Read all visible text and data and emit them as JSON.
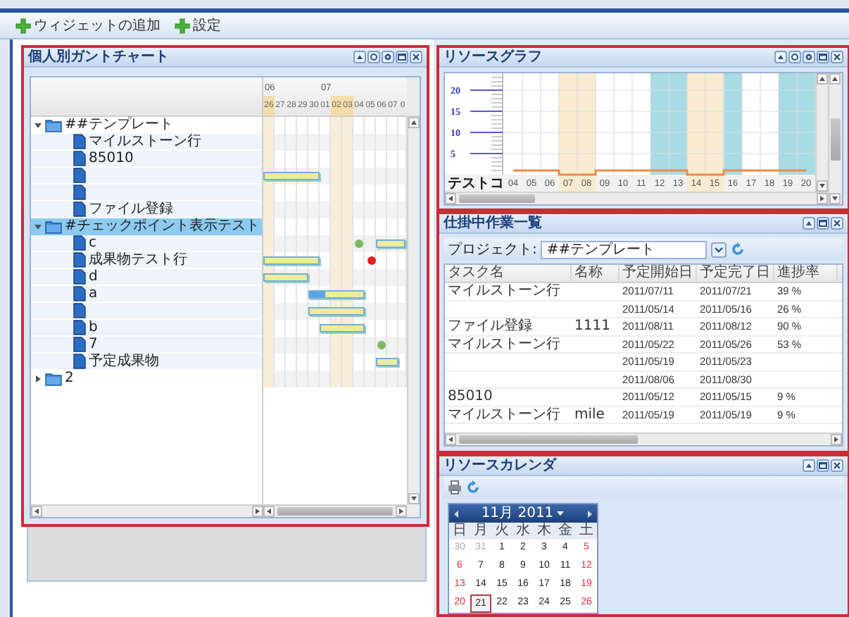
{
  "toolbar": {
    "buttons": [
      {
        "label": "ウィジェットの追加"
      },
      {
        "label": "設定"
      }
    ]
  },
  "gantt": {
    "title": "個人別ガントチャート",
    "months": [
      {
        "label": "06",
        "days": [
          {
            "label": "26",
            "weekend": true
          },
          {
            "label": "27",
            "weekend": false
          },
          {
            "label": "28",
            "weekend": false
          },
          {
            "label": "29",
            "weekend": false
          },
          {
            "label": "30",
            "weekend": false
          }
        ]
      },
      {
        "label": "07",
        "days": [
          {
            "label": "01",
            "weekend": false
          },
          {
            "label": "02",
            "weekend": true
          },
          {
            "label": "03",
            "weekend": true
          },
          {
            "label": "04",
            "weekend": false
          },
          {
            "label": "05",
            "weekend": false
          },
          {
            "label": "06",
            "weekend": false
          },
          {
            "label": "07",
            "weekend": false
          },
          {
            "label": "0",
            "weekend": false
          }
        ]
      }
    ],
    "tree": [
      {
        "label": "##テンプレート",
        "kind": "folder",
        "expanded": true,
        "selected": false,
        "children": [
          {
            "label": "マイルストーン行",
            "kind": "task",
            "selected": false
          },
          {
            "label": "85010",
            "kind": "task",
            "selected": false
          },
          {
            "kind": "task",
            "selected": false,
            "markers": [
              {
                "kind": "bar"
              }
            ]
          },
          {
            "kind": "task",
            "selected": false
          },
          {
            "label": "ファイル登録",
            "kind": "task",
            "selected": false
          }
        ]
      },
      {
        "label": "#チェックポイント表示テスト",
        "kind": "folder",
        "expanded": true,
        "selected": true,
        "children": [
          {
            "label": "c",
            "kind": "task",
            "selected": false,
            "markers": [
              {
                "kind": "dot",
                "color": "#7cb861"
              },
              {
                "kind": "bar"
              }
            ]
          },
          {
            "label": "成果物テスト行",
            "kind": "task",
            "selected": false,
            "markers": [
              {
                "kind": "bar"
              },
              {
                "kind": "dot",
                "color": "#e82020"
              }
            ]
          },
          {
            "label": "d",
            "kind": "task",
            "selected": false,
            "markers": [
              {
                "kind": "bar"
              }
            ]
          },
          {
            "label": "a",
            "kind": "task",
            "selected": false,
            "markers": [
              {
                "kind": "bar",
                "level": 0.3
              }
            ]
          },
          {
            "kind": "task",
            "selected": false,
            "markers": [
              {
                "kind": "bar"
              }
            ]
          },
          {
            "label": "b",
            "kind": "task",
            "selected": false,
            "markers": [
              {
                "kind": "bar"
              }
            ]
          },
          {
            "label": "7",
            "kind": "task",
            "selected": false,
            "markers": [
              {
                "kind": "dot",
                "color": "#7cb861"
              }
            ]
          },
          {
            "label": "予定成果物",
            "kind": "task",
            "selected": false,
            "markers": [
              {
                "kind": "bar"
              }
            ]
          }
        ]
      },
      {
        "label": "2",
        "kind": "folder",
        "expanded": false,
        "selected": false
      }
    ]
  },
  "resource_graph": {
    "title": "リソースグラフ",
    "chart_data": {
      "type": "line",
      "categories": [
        "04",
        "05",
        "06",
        "07",
        "08",
        "09",
        "10",
        "11",
        "12",
        "13",
        "14",
        "15",
        "16",
        "17",
        "18",
        "19",
        "20"
      ],
      "ylim": [
        0,
        24
      ],
      "yticks": [
        5,
        10,
        15,
        20
      ],
      "grid": true,
      "series": [
        {
          "name": "テストコ",
          "color": "#f08a4b",
          "values": [
            1,
            1,
            1,
            0,
            0,
            1,
            1,
            1,
            1,
            1,
            0,
            0,
            1,
            1,
            1,
            1,
            1
          ]
        }
      ]
    },
    "columns": [
      {
        "weekend": false,
        "busy": false
      },
      {
        "weekend": false,
        "busy": false
      },
      {
        "weekend": false,
        "busy": false
      },
      {
        "weekend": true,
        "busy": false
      },
      {
        "weekend": true,
        "busy": false
      },
      {
        "weekend": false,
        "busy": false
      },
      {
        "weekend": false,
        "busy": false
      },
      {
        "weekend": false,
        "busy": false
      },
      {
        "weekend": false,
        "busy": true
      },
      {
        "weekend": false,
        "busy": true
      },
      {
        "weekend": true,
        "busy": false
      },
      {
        "weekend": true,
        "busy": false
      },
      {
        "weekend": false,
        "busy": true
      },
      {
        "weekend": false,
        "busy": false
      },
      {
        "weekend": false,
        "busy": false
      },
      {
        "weekend": false,
        "busy": true
      },
      {
        "weekend": false,
        "busy": true
      }
    ]
  },
  "task_list": {
    "title": "仕掛中作業一覧",
    "project_label": "プロジェクト:",
    "project_value": "##テンプレート",
    "columns": [
      "タスク名",
      "名称",
      "予定開始日",
      "予定完了日",
      "進捗率"
    ],
    "rows": [
      {
        "task": "マイルストーン行",
        "start": "2011/07/11",
        "end": "2011/07/21",
        "progress": "39 %"
      },
      {
        "start": "2011/05/14",
        "end": "2011/05/16",
        "progress": "26 %"
      },
      {
        "task": "ファイル登録",
        "name": "1111",
        "start": "2011/08/11",
        "end": "2011/08/12",
        "progress": "90 %"
      },
      {
        "task": "マイルストーン行",
        "start": "2011/05/22",
        "end": "2011/05/26",
        "progress": "53 %"
      },
      {
        "start": "2011/05/19",
        "end": "2011/05/23"
      },
      {
        "start": "2011/08/06",
        "end": "2011/08/30"
      },
      {
        "task": "85010",
        "start": "2011/05/12",
        "end": "2011/05/15",
        "progress": "9 %"
      },
      {
        "task": "マイルストーン行",
        "name": "mile",
        "start": "2011/05/19",
        "end": "2011/05/19",
        "progress": "9 %"
      }
    ]
  },
  "calendar": {
    "title": "リソースカレンダ",
    "month_label": "11月 2011",
    "weekdays": [
      "日",
      "月",
      "火",
      "水",
      "木",
      "金",
      "土"
    ],
    "weeks": [
      [
        {
          "label": "30",
          "kind": "other"
        },
        {
          "label": "31",
          "kind": "other"
        },
        {
          "label": "1",
          "kind": "weekday"
        },
        {
          "label": "2",
          "kind": "weekday"
        },
        {
          "label": "3",
          "kind": "weekday"
        },
        {
          "label": "4",
          "kind": "weekday"
        },
        {
          "label": "5",
          "kind": "weekend"
        }
      ],
      [
        {
          "label": "6",
          "kind": "weekend"
        },
        {
          "label": "7",
          "kind": "weekday"
        },
        {
          "label": "8",
          "kind": "weekday"
        },
        {
          "label": "9",
          "kind": "weekday"
        },
        {
          "label": "10",
          "kind": "weekday"
        },
        {
          "label": "11",
          "kind": "weekday"
        },
        {
          "label": "12",
          "kind": "weekend"
        }
      ],
      [
        {
          "label": "13",
          "kind": "weekend"
        },
        {
          "label": "14",
          "kind": "weekday"
        },
        {
          "label": "15",
          "kind": "weekday"
        },
        {
          "label": "16",
          "kind": "weekday"
        },
        {
          "label": "17",
          "kind": "weekday"
        },
        {
          "label": "18",
          "kind": "weekday"
        },
        {
          "label": "19",
          "kind": "weekend"
        }
      ],
      [
        {
          "label": "20",
          "kind": "weekend"
        },
        {
          "label": "21",
          "kind": "today"
        },
        {
          "label": "22",
          "kind": "weekday"
        },
        {
          "label": "23",
          "kind": "weekday"
        },
        {
          "label": "24",
          "kind": "weekday"
        },
        {
          "label": "25",
          "kind": "weekday"
        },
        {
          "label": "26",
          "kind": "weekend"
        }
      ]
    ]
  }
}
